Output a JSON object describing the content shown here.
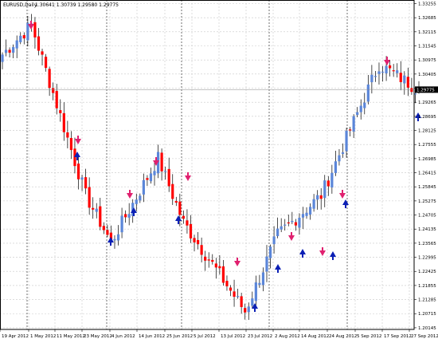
{
  "chart_header": {
    "symbol": "EURUSD,Daily",
    "ohlc": "1.30641 1.30739 1.29580 1.29775"
  },
  "current_price_label": "1.29775",
  "colors": {
    "bull_body": "#5b86d9",
    "bear_body": "#ff0000",
    "neutral_body": "#000000",
    "wick": "#000000",
    "grid": "#c8c8c8",
    "sell_arrow": "#e0206f",
    "buy_arrow": "#0b1fb5",
    "period_separator": "#333333"
  },
  "icons": {
    "sell_signal": "red-down-arrow-icon",
    "buy_signal": "blue-up-arrow-icon"
  },
  "chart_data": {
    "type": "candlestick",
    "title": "EURUSD,Daily",
    "ylim": [
      1.2,
      1.335
    ],
    "y_ticks": [
      "1.33255",
      "1.32685",
      "1.32115",
      "1.31545",
      "1.30975",
      "1.30405",
      "1.29835",
      "1.29265",
      "1.28695",
      "1.28125",
      "1.27555",
      "1.26985",
      "1.26415",
      "1.25845",
      "1.25275",
      "1.24705",
      "1.24135",
      "1.23565",
      "1.22995",
      "1.22425",
      "1.21855",
      "1.21285",
      "1.20715",
      "1.20145"
    ],
    "x_ticks": [
      "19 Apr 2012",
      "1 May 2012",
      "11 May 2012",
      "23 May 2012",
      "4 Jun 2012",
      "14 Jun 2012",
      "25 Jun 2012",
      "5 Jul 2012",
      "13 Jul 2012",
      "23 Jul 2012",
      "2 Aug 2012",
      "14 Aug 2012",
      "24 Aug 2012",
      "5 Sep 2012",
      "17 Sep 2012",
      "27 Sep 2012"
    ],
    "grid": true,
    "key_points": [
      {
        "date": "19 Apr 2012",
        "close": 1.312
      },
      {
        "date": "30 Apr 2012",
        "close": 1.324
      },
      {
        "date": "23 May 2012",
        "close": 1.255
      },
      {
        "date": "1 Jun 2012",
        "close": 1.236
      },
      {
        "date": "19 Jun 2012",
        "close": 1.27
      },
      {
        "date": "28 Jun 2012",
        "close": 1.244
      },
      {
        "date": "24 Jul 2012",
        "close": 1.208
      },
      {
        "date": "6 Aug 2012",
        "close": 1.239
      },
      {
        "date": "22 Aug 2012",
        "close": 1.255
      },
      {
        "date": "17 Sep 2012",
        "close": 1.308
      },
      {
        "date": "28 Sep 2012",
        "close": 1.29775
      }
    ],
    "signals": [
      {
        "type": "sell",
        "date": "30 Apr 2012"
      },
      {
        "type": "sell",
        "date": "21 May 2012"
      },
      {
        "type": "buy",
        "date": "22 May 2012"
      },
      {
        "type": "buy",
        "date": "5 Jun 2012"
      },
      {
        "type": "sell",
        "date": "13 Jun 2012"
      },
      {
        "type": "buy",
        "date": "14 Jun 2012"
      },
      {
        "type": "sell",
        "date": "22 Jun 2012"
      },
      {
        "type": "sell",
        "date": "28 Jun 2012"
      },
      {
        "type": "buy",
        "date": "3 Jul 2012"
      },
      {
        "type": "sell",
        "date": "17 Jul 2012"
      },
      {
        "type": "buy",
        "date": "24 Jul 2012"
      },
      {
        "type": "buy",
        "date": "2 Aug 2012"
      },
      {
        "type": "sell",
        "date": "6 Aug 2012"
      },
      {
        "type": "buy",
        "date": "9 Aug 2012"
      },
      {
        "type": "sell",
        "date": "14 Aug 2012"
      },
      {
        "type": "buy",
        "date": "16 Aug 2012"
      },
      {
        "type": "sell",
        "date": "22 Aug 2012"
      },
      {
        "type": "buy",
        "date": "24 Aug 2012"
      },
      {
        "type": "sell",
        "date": "17 Sep 2012"
      },
      {
        "type": "buy",
        "date": "28 Sep 2012"
      }
    ]
  }
}
